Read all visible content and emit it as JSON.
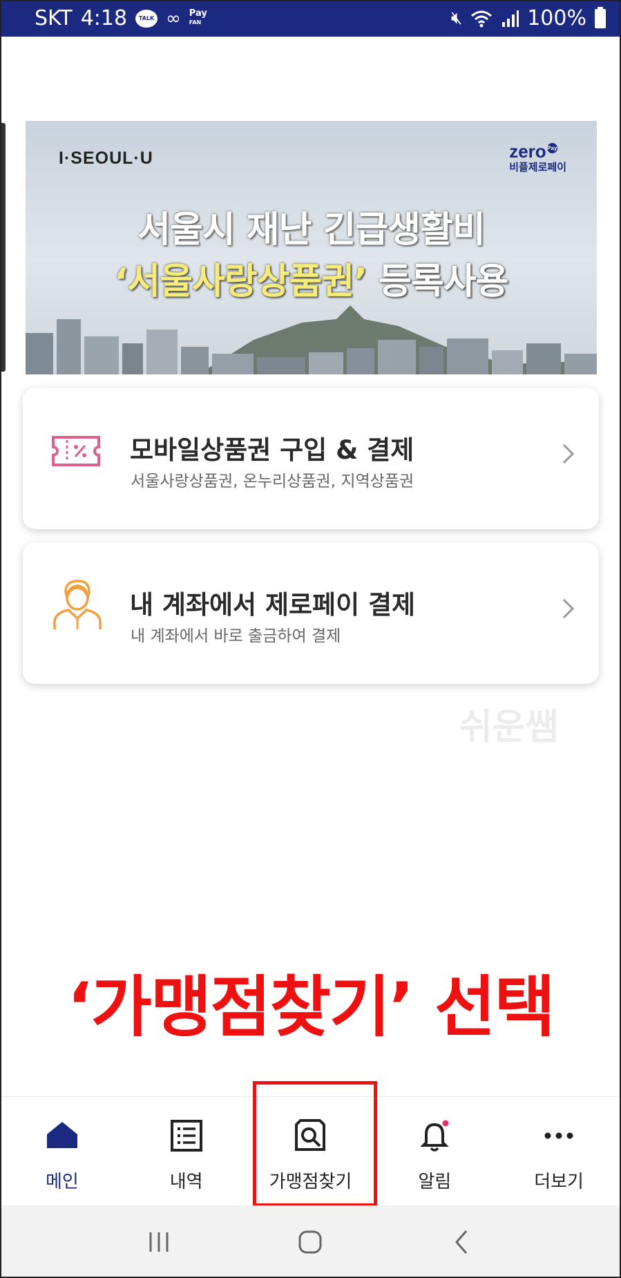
{
  "status_bar": {
    "carrier": "SKT",
    "time": "4:18",
    "talk_label": "TALK",
    "pay_label_top": "Pay",
    "pay_label_bottom": "FAN",
    "battery": "100%"
  },
  "banner": {
    "logo_text": "I·SEOUL·U",
    "zero_word": "zero",
    "zero_badge": "Pay",
    "zero_sub": "비플제로페이",
    "line1": "서울시 재난 긴급생활비",
    "line2_highlight": "‘서울사랑상품권’",
    "line2_rest": " 등록사용"
  },
  "cards": [
    {
      "title": "모바일상품권 구입 & 결제",
      "subtitle": "서울사랑상품권, 온누리상품권, 지역상품권",
      "icon": "ticket-icon"
    },
    {
      "title": "내 계좌에서 제로페이 결제",
      "subtitle": "내 계좌에서 바로 출금하여 결제",
      "icon": "person-icon"
    }
  ],
  "watermark": "쉬운쌤",
  "instruction": "‘가맹점찾기’ 선택",
  "bottom_nav": {
    "items": [
      {
        "label": "메인",
        "icon": "home-icon",
        "active": true
      },
      {
        "label": "내역",
        "icon": "list-icon",
        "active": false
      },
      {
        "label": "가맹점찾기",
        "icon": "store-search-icon",
        "active": false
      },
      {
        "label": "알림",
        "icon": "bell-icon",
        "active": false
      },
      {
        "label": "더보기",
        "icon": "more-icon",
        "active": false
      }
    ]
  },
  "colors": {
    "status_bar": "#1b2a80",
    "brand_navy": "#1b2a80",
    "highlight_red": "#ee1111",
    "ticket_pink": "#e0608a",
    "person_orange": "#f0a040"
  }
}
